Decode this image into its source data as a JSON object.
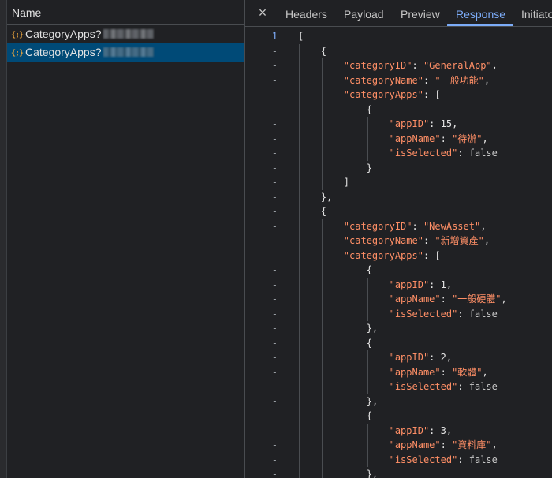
{
  "name_panel": {
    "header": "Name",
    "rows": [
      {
        "icon": "{;}",
        "label": "CategoryApps?",
        "selected": false
      },
      {
        "icon": "{;}",
        "label": "CategoryApps?",
        "selected": true
      }
    ]
  },
  "tabs": {
    "close_icon": "×",
    "items": [
      "Headers",
      "Payload",
      "Preview",
      "Response",
      "Initiator"
    ],
    "active": "Response"
  },
  "code": {
    "lines": [
      {
        "no": "1",
        "text": "["
      },
      {
        "no": "-",
        "text": "    {"
      },
      {
        "no": "-",
        "text": "        \"categoryID\": \"GeneralApp\","
      },
      {
        "no": "-",
        "text": "        \"categoryName\": \"一般功能\","
      },
      {
        "no": "-",
        "text": "        \"categoryApps\": ["
      },
      {
        "no": "-",
        "text": "            {"
      },
      {
        "no": "-",
        "text": "                \"appID\": 15,"
      },
      {
        "no": "-",
        "text": "                \"appName\": \"待辦\","
      },
      {
        "no": "-",
        "text": "                \"isSelected\": false"
      },
      {
        "no": "-",
        "text": "            }"
      },
      {
        "no": "-",
        "text": "        ]"
      },
      {
        "no": "-",
        "text": "    },"
      },
      {
        "no": "-",
        "text": "    {"
      },
      {
        "no": "-",
        "text": "        \"categoryID\": \"NewAsset\","
      },
      {
        "no": "-",
        "text": "        \"categoryName\": \"新增資產\","
      },
      {
        "no": "-",
        "text": "        \"categoryApps\": ["
      },
      {
        "no": "-",
        "text": "            {"
      },
      {
        "no": "-",
        "text": "                \"appID\": 1,"
      },
      {
        "no": "-",
        "text": "                \"appName\": \"一般硬體\","
      },
      {
        "no": "-",
        "text": "                \"isSelected\": false"
      },
      {
        "no": "-",
        "text": "            },"
      },
      {
        "no": "-",
        "text": "            {"
      },
      {
        "no": "-",
        "text": "                \"appID\": 2,"
      },
      {
        "no": "-",
        "text": "                \"appName\": \"軟體\","
      },
      {
        "no": "-",
        "text": "                \"isSelected\": false"
      },
      {
        "no": "-",
        "text": "            },"
      },
      {
        "no": "-",
        "text": "            {"
      },
      {
        "no": "-",
        "text": "                \"appID\": 3,"
      },
      {
        "no": "-",
        "text": "                \"appName\": \"資料庫\","
      },
      {
        "no": "-",
        "text": "                \"isSelected\": false"
      },
      {
        "no": "-",
        "text": "            },"
      }
    ]
  },
  "colors": {
    "background": "#202124",
    "selected_row": "#004a77",
    "accent": "#7cacf8",
    "json_key": "#ff8f66",
    "json_icon": "#e8a33d"
  }
}
